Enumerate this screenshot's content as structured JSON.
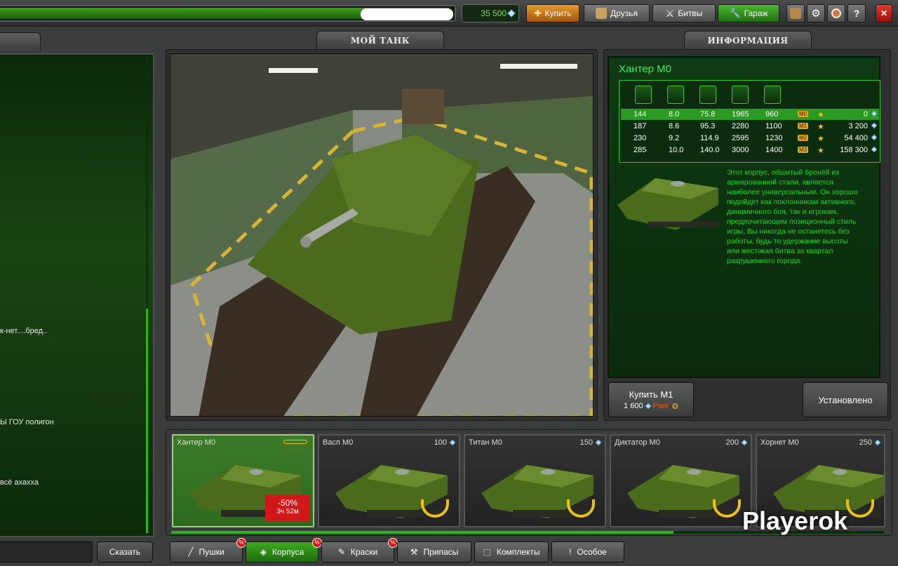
{
  "topbar": {
    "crystals": "35 500",
    "buy_label": "Купить",
    "friends_label": "Друзья",
    "battles_label": "Битвы",
    "garage_label": "Гараж",
    "close_label": "✕",
    "help_label": "?"
  },
  "tabs": {
    "my_tank": "МОЙ ТАНК",
    "info": "ИНФОРМАЦИЯ"
  },
  "chat": {
    "messages": [
      "к-нет....бред..",
      "Ы ГОУ полигон",
      "всё ахахха"
    ],
    "say_label": "Сказать"
  },
  "info": {
    "title": "Хантер М0",
    "stats_rows": [
      {
        "armor": "144",
        "speed": "8.0",
        "turn": "75.8",
        "weight": "1965",
        "power": "960",
        "mod": "M0",
        "price": "0"
      },
      {
        "armor": "187",
        "speed": "8.6",
        "turn": "95.3",
        "weight": "2280",
        "power": "1100",
        "mod": "M1",
        "price": "3 200"
      },
      {
        "armor": "230",
        "speed": "9.2",
        "turn": "114.9",
        "weight": "2595",
        "power": "1230",
        "mod": "M2",
        "price": "54 400"
      },
      {
        "armor": "285",
        "speed": "10.0",
        "turn": "140.0",
        "weight": "3000",
        "power": "1400",
        "mod": "M3",
        "price": "158 300"
      }
    ],
    "description": "Этот корпус, обшитый бронёй из армированной стали, является наиболее универсальным. Он хорошо подойдет как поклонникам активного, динамичного боя, так и игрокам, предпочитающим позиционный стиль игры. Вы никогда не останетесь без работы, будь то удержание высоты или жестокая битва за квартал разрушенного города.",
    "buy_button": "Купить М1",
    "buy_price": "1 600",
    "rank_label": "Ранг",
    "installed_button": "Установлено"
  },
  "cards": [
    {
      "name": "Хантер М0",
      "price": "",
      "sale": "-50%",
      "timer": "3ч 52м"
    },
    {
      "name": "Васп М0",
      "price": "100"
    },
    {
      "name": "Титан М0",
      "price": "150"
    },
    {
      "name": "Диктатор М0",
      "price": "200"
    },
    {
      "name": "Хорнет М0",
      "price": "250"
    }
  ],
  "categories": [
    "Пушки",
    "Корпуса",
    "Краски",
    "Припасы",
    "Комплекты",
    "Особое"
  ],
  "watermark": "Playerok",
  "colors": {
    "accent_green": "#34b01f",
    "info_text": "#1fd327",
    "sale_red": "#d01818"
  }
}
